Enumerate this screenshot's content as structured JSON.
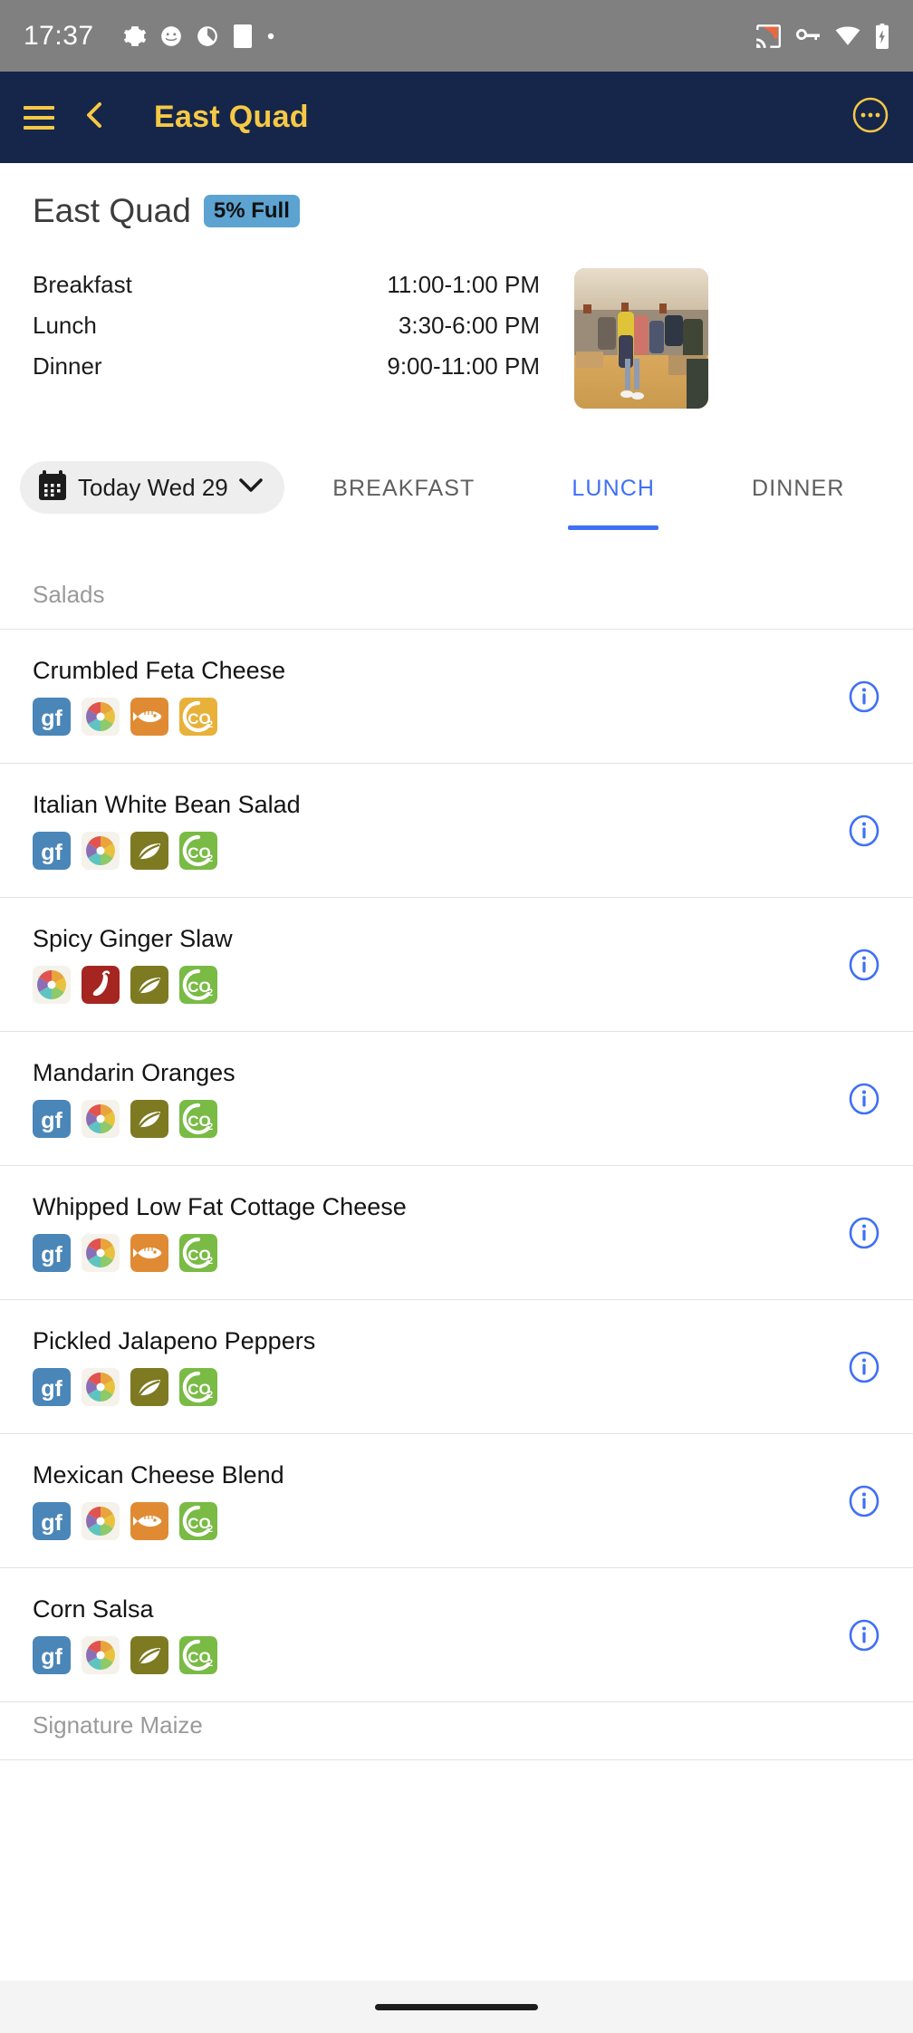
{
  "status_bar": {
    "time": "17:37",
    "left_icons": [
      "gear-icon",
      "emoji-icon",
      "sync-icon",
      "square-icon",
      "dot-icon"
    ],
    "right_icons": [
      "cast-icon",
      "vpn-key-icon",
      "wifi-icon",
      "battery-charging-icon"
    ]
  },
  "app_bar": {
    "menu_icon": "hamburger-menu-icon",
    "back_icon": "back-arrow-icon",
    "title": "East Quad",
    "overflow_icon": "more-options-icon",
    "bg_color": "#16264a",
    "accent_color": "#f6c945"
  },
  "page": {
    "title": "East Quad",
    "occupancy_badge": "5% Full",
    "badge_color": "#5ca3d1",
    "photo_alt": "dining-hall-photo"
  },
  "hours": [
    {
      "meal": "Breakfast",
      "time": "11:00-1:00 PM"
    },
    {
      "meal": "Lunch",
      "time": "3:30-6:00 PM"
    },
    {
      "meal": "Dinner",
      "time": "9:00-11:00 PM"
    }
  ],
  "date_picker": {
    "icon": "calendar-icon",
    "label": "Today Wed 29",
    "chevron": "chevron-down-icon"
  },
  "meal_tabs": [
    {
      "label": "BREAKFAST",
      "active": false
    },
    {
      "label": "LUNCH",
      "active": true
    },
    {
      "label": "DINNER",
      "active": false
    }
  ],
  "active_tab_color": "#4070f4",
  "sections": [
    {
      "name": "Salads",
      "items": [
        {
          "name": "Crumbled Feta Cheese",
          "tags": [
            "gluten-free",
            "halal",
            "fish",
            "carbon-medium"
          ]
        },
        {
          "name": "Italian White Bean Salad",
          "tags": [
            "gluten-free",
            "halal",
            "vegan",
            "carbon-low"
          ]
        },
        {
          "name": "Spicy Ginger Slaw",
          "tags": [
            "halal",
            "spicy",
            "vegan",
            "carbon-low"
          ]
        },
        {
          "name": "Mandarin Oranges",
          "tags": [
            "gluten-free",
            "halal",
            "vegan",
            "carbon-low"
          ]
        },
        {
          "name": "Whipped Low Fat Cottage Cheese",
          "tags": [
            "gluten-free",
            "halal",
            "fish",
            "carbon-low"
          ]
        },
        {
          "name": "Pickled Jalapeno Peppers",
          "tags": [
            "gluten-free",
            "halal",
            "vegan",
            "carbon-low"
          ]
        },
        {
          "name": "Mexican Cheese Blend",
          "tags": [
            "gluten-free",
            "halal",
            "fish",
            "carbon-low"
          ]
        },
        {
          "name": "Corn Salsa",
          "tags": [
            "gluten-free",
            "halal",
            "vegan",
            "carbon-low"
          ]
        }
      ]
    },
    {
      "name": "Signature Maize",
      "items": []
    }
  ],
  "info_icon": "info-circle-icon",
  "tag_styles": {
    "gluten-free": {
      "label": "gf",
      "bg": "#4a86b8"
    },
    "halal": {
      "label": "",
      "bg": "#f0efe8"
    },
    "vegan": {
      "label": "",
      "bg": "#7d7a22"
    },
    "fish": {
      "label": "",
      "bg": "#e08b33"
    },
    "spicy": {
      "label": "",
      "bg": "#a52521"
    },
    "carbon-low": {
      "label": "CO2",
      "bg": "#79bb45"
    },
    "carbon-medium": {
      "label": "CO2",
      "bg": "#e8b13a"
    }
  }
}
